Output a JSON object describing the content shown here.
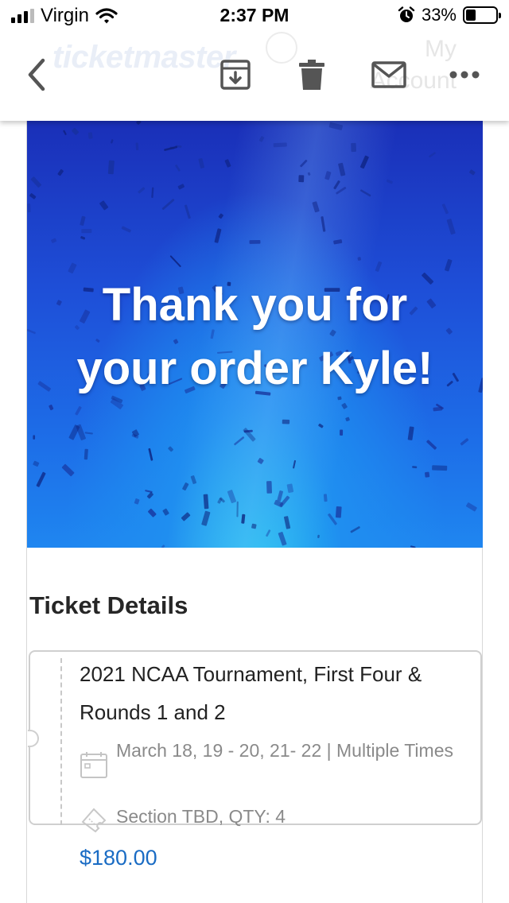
{
  "status_bar": {
    "carrier": "Virgin",
    "time": "2:37 PM",
    "battery_percent": "33%",
    "battery_level": 0.33,
    "icons": [
      "signal-bars",
      "wifi",
      "alarm-clock",
      "battery"
    ]
  },
  "toolbar": {
    "back_icon": "chevron-left-icon",
    "archive_icon": "archive-download-icon",
    "trash_icon": "trash-icon",
    "mail_icon": "envelope-icon",
    "more_icon": "ellipsis-icon",
    "ghost_logo": "ticketmaster",
    "ghost_account": "My Account"
  },
  "hero": {
    "line1": "Thank you for",
    "line2": "your order Kyle!",
    "colors": {
      "top": "#1a2fb8",
      "bottom": "#1f86f0",
      "glow": "#22c8f0"
    }
  },
  "ticket_details": {
    "heading": "Ticket Details",
    "event_name": "2021 NCAA Tournament, First Four & Rounds 1 and 2",
    "dates": "March 18, 19 - 20, 21- 22 | Multiple Times",
    "section": "Section TBD, QTY: 4",
    "calendar_icon": "calendar-icon",
    "ticket_icon": "ticket-icon",
    "price": "$180.00",
    "price_color": "#1a6cc4"
  }
}
